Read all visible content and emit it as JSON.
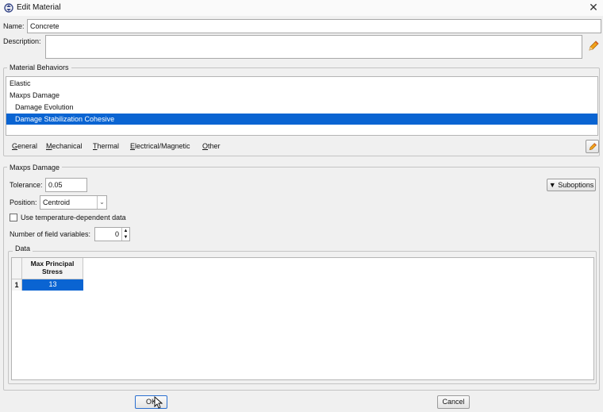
{
  "window": {
    "title": "Edit Material"
  },
  "name": {
    "label": "Name:",
    "value": "Concrete"
  },
  "description": {
    "label": "Description:",
    "value": ""
  },
  "behaviors": {
    "title": "Material Behaviors",
    "items": [
      {
        "label": "Elastic",
        "indent": false,
        "selected": false
      },
      {
        "label": "Maxps Damage",
        "indent": false,
        "selected": false
      },
      {
        "label": "Damage Evolution",
        "indent": true,
        "selected": false
      },
      {
        "label": "Damage Stabilization Cohesive",
        "indent": true,
        "selected": true
      }
    ],
    "selection_color": "#0a64d2"
  },
  "menubar": {
    "items": [
      {
        "label": "General",
        "mnemonic": "G"
      },
      {
        "label": "Mechanical",
        "mnemonic": "M"
      },
      {
        "label": "Thermal",
        "mnemonic": "T"
      },
      {
        "label": "Electrical/Magnetic",
        "mnemonic": "E"
      },
      {
        "label": "Other",
        "mnemonic": "O"
      }
    ]
  },
  "section": {
    "title": "Maxps Damage",
    "suboptions_label": "Suboptions",
    "tolerance": {
      "label": "Tolerance:",
      "value": "0.05"
    },
    "position": {
      "label": "Position:",
      "value": "Centroid"
    },
    "temp_dependent": {
      "label": "Use temperature-dependent data",
      "checked": false
    },
    "field_vars": {
      "label": "Number of field variables:",
      "value": "0"
    }
  },
  "data_table": {
    "title": "Data",
    "columns": [
      "Max Principal Stress"
    ],
    "column_lines": [
      "Max Principal",
      "Stress"
    ],
    "rows": [
      {
        "index": "1",
        "values": [
          "13"
        ]
      }
    ]
  },
  "buttons": {
    "ok": "OK",
    "cancel": "Cancel"
  }
}
